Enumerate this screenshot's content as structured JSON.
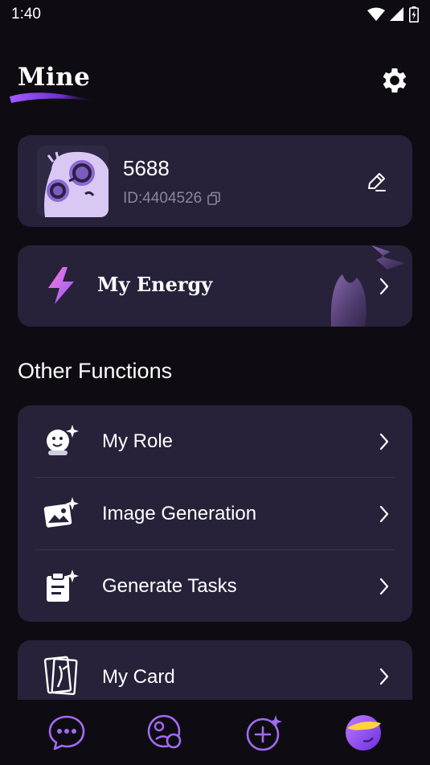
{
  "status_bar": {
    "time": "1:40"
  },
  "header": {
    "title": "Mine"
  },
  "profile": {
    "username": "5688",
    "user_id": "ID:4404526"
  },
  "energy": {
    "label": "My Energy"
  },
  "section": {
    "title": "Other Functions"
  },
  "functions": [
    {
      "label": "My Role",
      "icon": "role-sparkle-icon"
    },
    {
      "label": "Image Generation",
      "icon": "image-sparkle-icon"
    },
    {
      "label": "Generate Tasks",
      "icon": "clipboard-sparkle-icon"
    }
  ],
  "card_item": {
    "label": "My Card",
    "icon": "card-icon"
  },
  "colors": {
    "accent": "#8b45f5",
    "card_bg": "#27223a",
    "page_bg": "#0e0c12",
    "nav_icon": "#a16bf0"
  },
  "nav": {
    "items": [
      "chat-icon",
      "discover-icon",
      "create-icon",
      "profile-avatar-icon"
    ]
  }
}
